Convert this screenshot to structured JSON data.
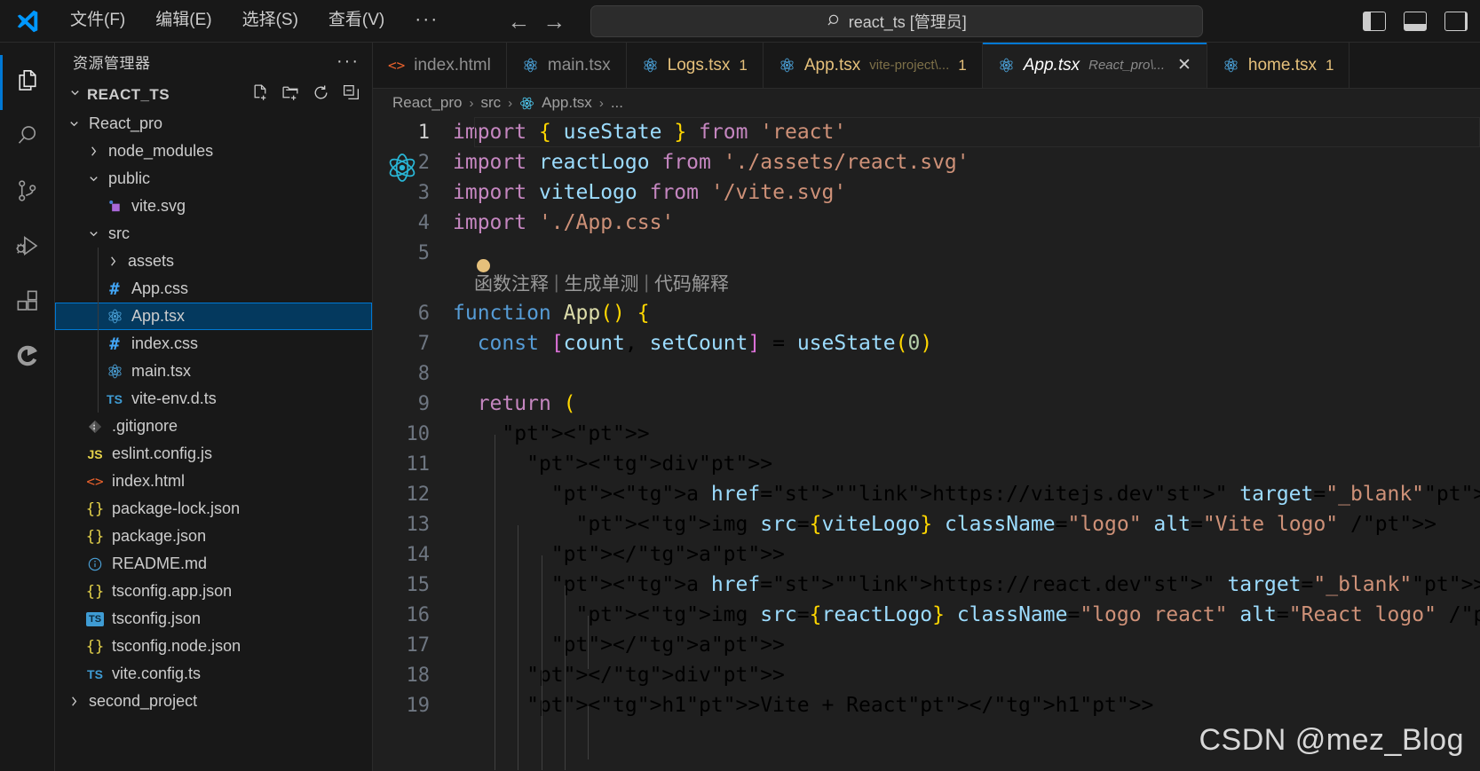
{
  "titlebar": {
    "logo_icon": "vscode-logo",
    "menus": [
      {
        "label": "文件(F)",
        "name": "menu-file"
      },
      {
        "label": "编辑(E)",
        "name": "menu-edit"
      },
      {
        "label": "选择(S)",
        "name": "menu-selection"
      },
      {
        "label": "查看(V)",
        "name": "menu-view"
      },
      {
        "label": "···",
        "name": "menu-more"
      }
    ],
    "nav": {
      "back": "←",
      "forward": "→"
    },
    "command_center": {
      "search_icon": "search-icon",
      "text": "react_ts [管理员]"
    },
    "layout_buttons": [
      {
        "name": "toggle-primary-sidebar",
        "icon": "layout-panel-left-icon"
      },
      {
        "name": "toggle-panel",
        "icon": "layout-panel-bottom-icon"
      },
      {
        "name": "toggle-secondary-sidebar",
        "icon": "layout-panel-right-icon"
      }
    ]
  },
  "activitybar": {
    "items": [
      {
        "name": "activity-explorer",
        "icon": "files-icon",
        "active": true
      },
      {
        "name": "activity-search",
        "icon": "search-icon",
        "active": false
      },
      {
        "name": "activity-source-control",
        "icon": "source-control-icon",
        "active": false
      },
      {
        "name": "activity-run-debug",
        "icon": "run-and-debug-icon",
        "active": false
      },
      {
        "name": "activity-extensions",
        "icon": "extensions-icon",
        "active": false
      },
      {
        "name": "activity-copilot",
        "icon": "copilot-icon",
        "active": false
      }
    ]
  },
  "sidebar": {
    "title": "资源管理器",
    "more_actions": "···",
    "root": {
      "label": "REACT_TS",
      "chevron": "⌄",
      "actions": [
        {
          "name": "new-file-button",
          "icon": "new-file-icon"
        },
        {
          "name": "new-folder-button",
          "icon": "new-folder-icon"
        },
        {
          "name": "refresh-explorer-button",
          "icon": "refresh-icon"
        },
        {
          "name": "collapse-folders-button",
          "icon": "collapse-all-icon"
        }
      ]
    },
    "tree": [
      {
        "label": "React_pro",
        "type": "folder",
        "state": "expanded",
        "depth": 1,
        "icon": "chevron-down-icon"
      },
      {
        "label": "node_modules",
        "type": "folder",
        "state": "collapsed",
        "depth": 2,
        "icon": "chevron-right-icon"
      },
      {
        "label": "public",
        "type": "folder",
        "state": "expanded",
        "depth": 2,
        "icon": "chevron-down-icon"
      },
      {
        "label": "vite.svg",
        "type": "file",
        "depth": 3,
        "icon": "svg-file-icon"
      },
      {
        "label": "src",
        "type": "folder",
        "state": "expanded",
        "depth": 2,
        "icon": "chevron-down-icon"
      },
      {
        "label": "assets",
        "type": "folder",
        "state": "collapsed",
        "depth": 3,
        "icon": "chevron-right-icon"
      },
      {
        "label": "App.css",
        "type": "file",
        "depth": 3,
        "icon": "css-file-icon"
      },
      {
        "label": "App.tsx",
        "type": "file",
        "depth": 3,
        "icon": "react-file-icon",
        "selected": true
      },
      {
        "label": "index.css",
        "type": "file",
        "depth": 3,
        "icon": "css-file-icon"
      },
      {
        "label": "main.tsx",
        "type": "file",
        "depth": 3,
        "icon": "react-file-icon"
      },
      {
        "label": "vite-env.d.ts",
        "type": "file",
        "depth": 3,
        "icon": "ts-file-icon"
      },
      {
        "label": ".gitignore",
        "type": "file",
        "depth": 2,
        "icon": "git-file-icon"
      },
      {
        "label": "eslint.config.js",
        "type": "file",
        "depth": 2,
        "icon": "js-file-icon"
      },
      {
        "label": "index.html",
        "type": "file",
        "depth": 2,
        "icon": "html-file-icon"
      },
      {
        "label": "package-lock.json",
        "type": "file",
        "depth": 2,
        "icon": "json-file-icon"
      },
      {
        "label": "package.json",
        "type": "file",
        "depth": 2,
        "icon": "json-file-icon"
      },
      {
        "label": "README.md",
        "type": "file",
        "depth": 2,
        "icon": "markdown-file-icon"
      },
      {
        "label": "tsconfig.app.json",
        "type": "file",
        "depth": 2,
        "icon": "json-file-icon"
      },
      {
        "label": "tsconfig.json",
        "type": "file",
        "depth": 2,
        "icon": "tsconfig-file-icon"
      },
      {
        "label": "tsconfig.node.json",
        "type": "file",
        "depth": 2,
        "icon": "json-file-icon"
      },
      {
        "label": "vite.config.ts",
        "type": "file",
        "depth": 2,
        "icon": "ts-file-icon"
      },
      {
        "label": "second_project",
        "type": "folder",
        "state": "collapsed",
        "depth": 1,
        "icon": "chevron-right-icon"
      }
    ]
  },
  "editor": {
    "tabs": [
      {
        "name": "index.html",
        "desc": "",
        "badge": "",
        "icon": "html-file-icon",
        "active": false,
        "dirty": false,
        "close": false
      },
      {
        "name": "main.tsx",
        "desc": "",
        "badge": "",
        "icon": "react-file-icon",
        "active": false,
        "dirty": false,
        "close": false
      },
      {
        "name": "Logs.tsx",
        "desc": "",
        "badge": "1",
        "icon": "react-file-icon",
        "active": false,
        "dirty": true,
        "close": false
      },
      {
        "name": "App.tsx",
        "desc": "vite-project\\...",
        "badge": "1",
        "icon": "react-file-icon",
        "active": false,
        "dirty": true,
        "close": false
      },
      {
        "name": "App.tsx",
        "desc": "React_pro\\...",
        "badge": "",
        "icon": "react-file-icon",
        "active": true,
        "dirty": false,
        "close": true,
        "close_label": "✕"
      },
      {
        "name": "home.tsx",
        "desc": "",
        "badge": "1",
        "icon": "react-file-icon",
        "active": false,
        "dirty": true,
        "close": false
      }
    ],
    "breadcrumb": [
      "React_pro",
      "src",
      "App.tsx",
      "..."
    ],
    "breadcrumb_separator": "›",
    "codelens": {
      "items": [
        "函数注释",
        "生成单测",
        "代码解释"
      ],
      "separator": "|"
    },
    "watermark": "CSDN @mez_Blog",
    "lines": [
      {
        "n": "1",
        "current": true,
        "text": "import { useState } from 'react'"
      },
      {
        "n": "2",
        "current": false,
        "text": "import reactLogo from './assets/react.svg'"
      },
      {
        "n": "3",
        "current": false,
        "text": "import viteLogo from '/vite.svg'"
      },
      {
        "n": "4",
        "current": false,
        "text": "import './App.css'"
      },
      {
        "n": "5",
        "current": false,
        "text": ""
      },
      {
        "n": "6",
        "current": false,
        "text": "function App() {"
      },
      {
        "n": "7",
        "current": false,
        "text": "  const [count, setCount] = useState(0)"
      },
      {
        "n": "8",
        "current": false,
        "text": ""
      },
      {
        "n": "9",
        "current": false,
        "text": "  return ("
      },
      {
        "n": "10",
        "current": false,
        "text": "    <>"
      },
      {
        "n": "11",
        "current": false,
        "text": "      <div>"
      },
      {
        "n": "12",
        "current": false,
        "text": "        <a href=\"https://vitejs.dev\" target=\"_blank\">"
      },
      {
        "n": "13",
        "current": false,
        "text": "          <img src={viteLogo} className=\"logo\" alt=\"Vite logo\" />"
      },
      {
        "n": "14",
        "current": false,
        "text": "        </a>"
      },
      {
        "n": "15",
        "current": false,
        "text": "        <a href=\"https://react.dev\" target=\"_blank\">"
      },
      {
        "n": "16",
        "current": false,
        "text": "          <img src={reactLogo} className=\"logo react\" alt=\"React logo\" />"
      },
      {
        "n": "17",
        "current": false,
        "text": "        </a>"
      },
      {
        "n": "18",
        "current": false,
        "text": "      </div>"
      },
      {
        "n": "19",
        "current": false,
        "text": "      <h1>Vite + React</h1>"
      }
    ]
  },
  "colors": {
    "accent": "#0078d4",
    "selection": "#04395e",
    "editor_bg": "#1f1f1f",
    "chrome_bg": "#181818",
    "keyword": "#c586c0",
    "string": "#ce9178",
    "identifier": "#9cdcfe",
    "dirty_tab": "#e5c07b"
  }
}
